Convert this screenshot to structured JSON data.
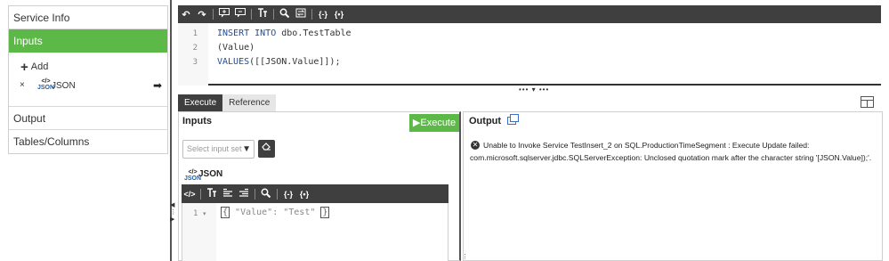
{
  "sidebar": {
    "items": [
      {
        "label": "Service Info"
      },
      {
        "label": "Inputs"
      },
      {
        "label": "Output"
      },
      {
        "label": "Tables/Columns"
      }
    ],
    "inputs": {
      "add_label": "Add",
      "remove_symbol": "×",
      "json_icon_text": "JSON",
      "json_label": "JSON",
      "arrow_symbol": "➡"
    }
  },
  "code_editor": {
    "toolbar": [
      "undo-icon",
      "redo-icon",
      "insert-comment-icon",
      "remove-comment-icon",
      "text-size-icon",
      "search-icon",
      "replace-icon",
      "wrap-braces-icon",
      "format-braces-icon"
    ],
    "lines": [
      {
        "n": "1",
        "parts": [
          {
            "t": "INSERT INTO",
            "kw": true
          },
          {
            "t": " dbo.TestTable",
            "kw": false
          }
        ]
      },
      {
        "n": "2",
        "parts": [
          {
            "t": "(Value)",
            "kw": false
          }
        ]
      },
      {
        "n": "3",
        "parts": [
          {
            "t": "VALUES",
            "kw": true
          },
          {
            "t": "([[JSON.Value]]);",
            "kw": false
          }
        ]
      }
    ]
  },
  "tabs": [
    {
      "label": "Execute",
      "active": true
    },
    {
      "label": "Reference",
      "active": false
    }
  ],
  "inputs_pane": {
    "title": "Inputs",
    "execute_label": "Execute",
    "select_placeholder": "Select input set",
    "json_icon_text": "JSON",
    "json_label": "JSON",
    "editor_line_number": "1",
    "editor_open_brace": "{",
    "editor_text": " \"Value\": \"Test\" ",
    "editor_close_brace": "}"
  },
  "output_pane": {
    "title": "Output",
    "error_line1": "Unable to Invoke Service TestInsert_2 on SQL.ProductionTimeSegment : Execute Update failed:",
    "error_line2": "com.microsoft.sqlserver.jdbc.SQLServerException: Unclosed quotation mark after the character string '[JSON.Value]);'."
  },
  "colors": {
    "accent_green": "#5cb947",
    "toolbar_dark": "#3f3f3f",
    "keyword_blue": "#1a4fa0"
  }
}
